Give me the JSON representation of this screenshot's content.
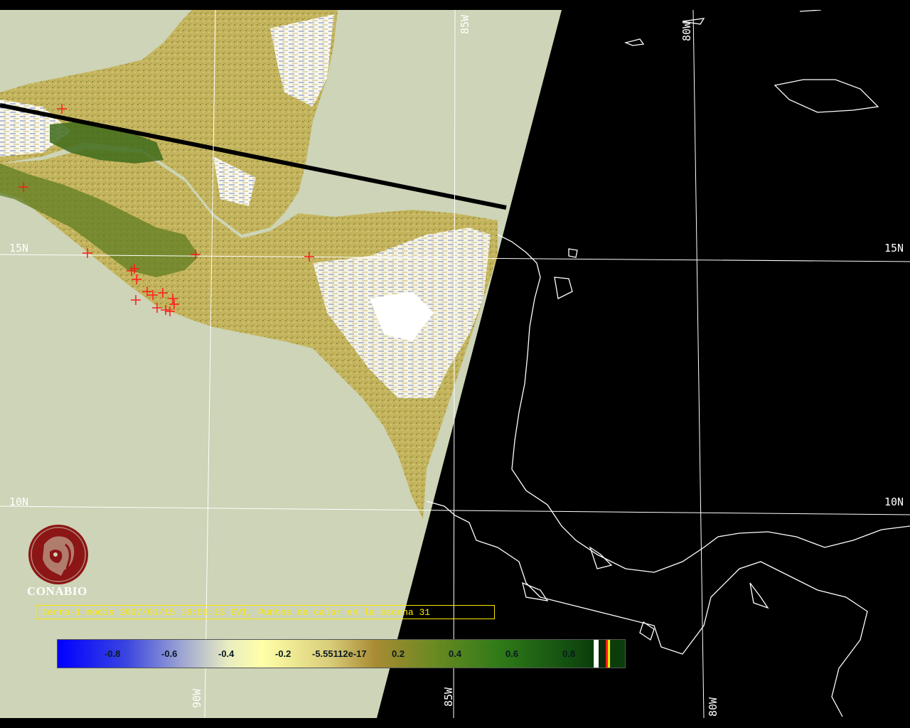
{
  "map": {
    "grid_labels": {
      "lat_15n_left": "15N",
      "lat_15n_right": "15N",
      "lat_10n_left": "10N",
      "lat_10n_right": "10N",
      "lon_85w_top": "85W",
      "lon_80w_top": "80W",
      "lon_90w_bottom": "90W",
      "lon_85w_bottom": "85W",
      "lon_80w_bottom": "80W"
    },
    "hotspot_count": 17,
    "colors": {
      "background": "#000000",
      "no_data_swath": "#cdd4b7",
      "coastline": "#ffffff",
      "gridline": "#ffffff",
      "hotspot": "#ff1a1a",
      "orbit_line": "#000000"
    }
  },
  "branding": {
    "organization": "CONABIO"
  },
  "caption": {
    "text": "terra-1 modis 2007/01/15 16:53:13 EVI, Puntos de calor en la escena 31"
  },
  "scale_bar": {
    "ticks": [
      "-0.8",
      "-0.6",
      "-0.4",
      "-0.2",
      "-5.55112e-17",
      "0.2",
      "0.4",
      "0.6",
      "0.8"
    ],
    "min": -1,
    "max": 1,
    "colors": {
      "low": "#0000ff",
      "mid_low": "#ffffa8",
      "mid": "#a88b32",
      "high": "#0a3d0a"
    }
  }
}
